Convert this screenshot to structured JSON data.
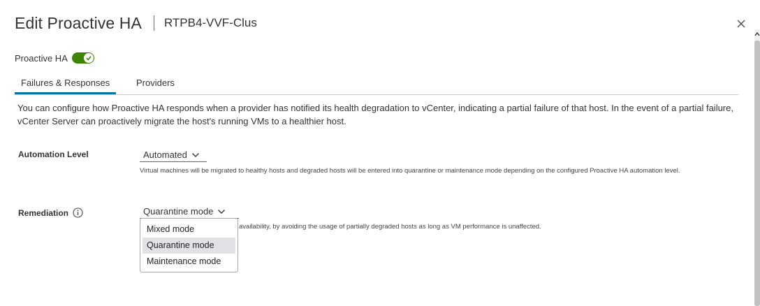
{
  "dialog": {
    "title": "Edit Proactive HA",
    "subtitle": "RTPB4-VVF-Clus",
    "close_icon": "close-icon"
  },
  "toggle": {
    "label": "Proactive HA",
    "enabled": true,
    "color": "#3c8500"
  },
  "tabs": [
    {
      "label": "Failures & Responses",
      "active": true
    },
    {
      "label": "Providers",
      "active": false
    }
  ],
  "description": "You can configure how Proactive HA responds when a provider has notified its health degradation to vCenter, indicating a partial failure of that host. In the event of a partial failure, vCenter Server can proactively migrate the host's running VMs to a healthier host.",
  "automation": {
    "label": "Automation Level",
    "value": "Automated",
    "hint": "Virtual machines will be migrated to healthy hosts and degraded hosts will be entered into quarantine or maintenance mode depending on the configured Proactive HA automation level."
  },
  "remediation": {
    "label": "Remediation",
    "value": "Quarantine mode",
    "hint": "availability, by avoiding the usage of partially degraded hosts as long as VM performance is unaffected.",
    "options": [
      "Mixed mode",
      "Quarantine mode",
      "Maintenance mode"
    ],
    "selected_index": 1
  },
  "colors": {
    "accent": "#0072a3",
    "toggle_on": "#3c8500"
  }
}
